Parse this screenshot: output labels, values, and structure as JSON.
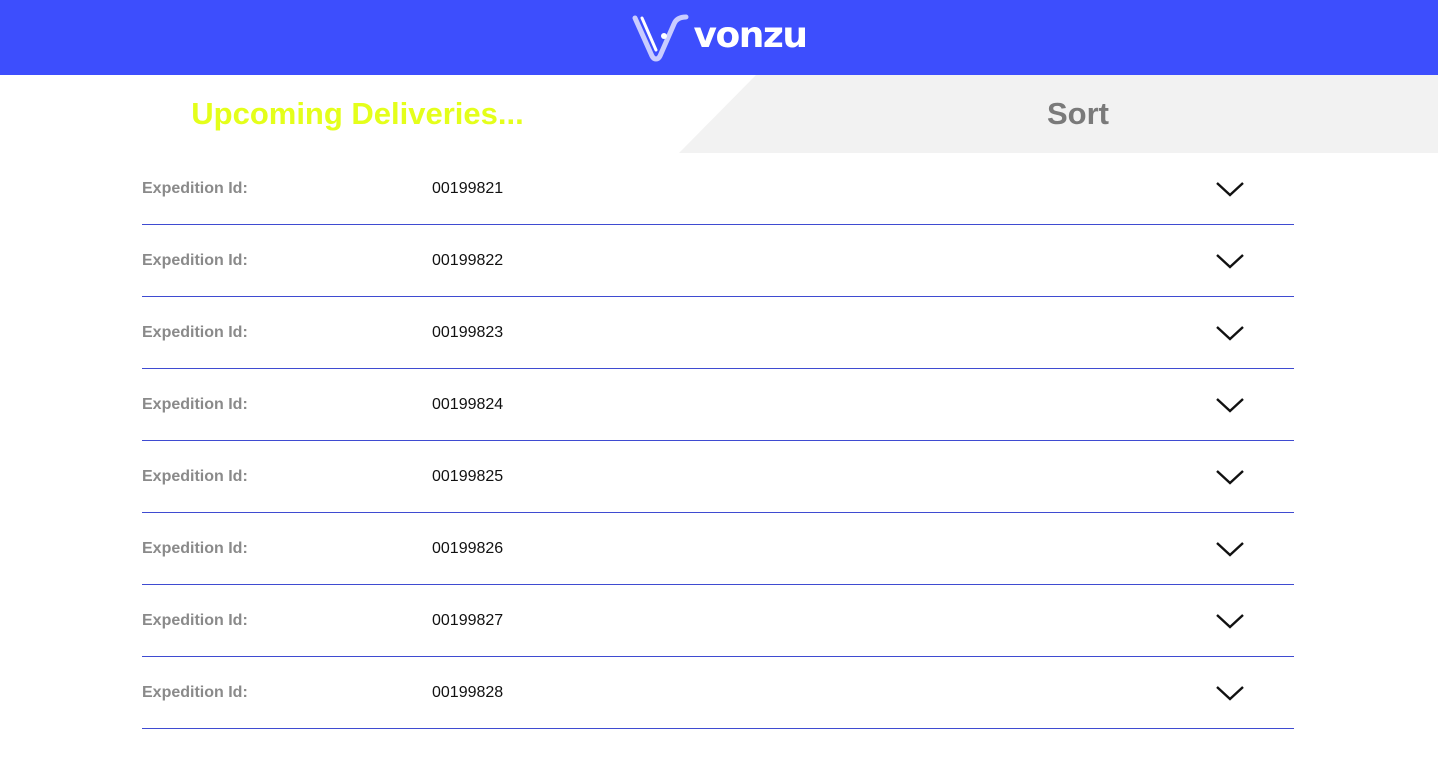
{
  "header": {
    "brand": "vonzu",
    "logo_icon": "vonzu-v-logo-icon",
    "background_color": "#3d4efd"
  },
  "tabs": {
    "upcoming_label": "Upcoming Deliveries...",
    "sort_label": "Sort",
    "upcoming_color": "#e4ff1a",
    "sort_background": "#f2f2f2"
  },
  "expeditions": [
    {
      "label": "Expedition Id:",
      "id": "00199821",
      "icon": "chevron-down-icon"
    },
    {
      "label": "Expedition Id:",
      "id": "00199822",
      "icon": "chevron-down-icon"
    },
    {
      "label": "Expedition Id:",
      "id": "00199823",
      "icon": "chevron-down-icon"
    },
    {
      "label": "Expedition Id:",
      "id": "00199824",
      "icon": "chevron-down-icon"
    },
    {
      "label": "Expedition Id:",
      "id": "00199825",
      "icon": "chevron-down-icon"
    },
    {
      "label": "Expedition Id:",
      "id": "00199826",
      "icon": "chevron-down-icon"
    },
    {
      "label": "Expedition Id:",
      "id": "00199827",
      "icon": "chevron-down-icon"
    },
    {
      "label": "Expedition Id:",
      "id": "00199828",
      "icon": "chevron-down-icon"
    }
  ],
  "divider_color": "#3f4bd1"
}
